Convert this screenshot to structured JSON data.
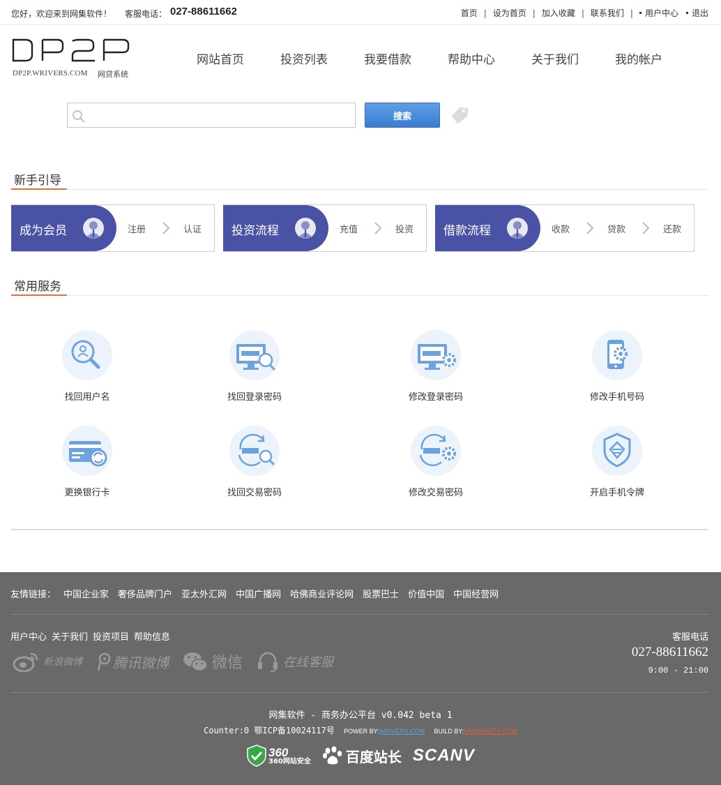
{
  "topbar": {
    "welcome": "您好，欢迎来到网集软件！",
    "service_label": "客服电话：",
    "service_phone": "027-88611662",
    "links": [
      "首页",
      "设为首页",
      "加入收藏",
      "联系我们",
      "用户中心",
      "退出"
    ]
  },
  "logo": {
    "text": "DP2P",
    "domain": "DP2P.WRIVERS.COM",
    "subtitle": "网贷系统"
  },
  "nav": [
    "网站首页",
    "投资列表",
    "我要借款",
    "帮助中心",
    "关于我们",
    "我的帐户"
  ],
  "search": {
    "placeholder": "",
    "button": "搜索"
  },
  "guide": {
    "title": "新手引导",
    "cards": [
      {
        "title": "成为会员",
        "steps": [
          "注册",
          "认证"
        ]
      },
      {
        "title": "投资流程",
        "steps": [
          "充值",
          "投资"
        ]
      },
      {
        "title": "借款流程",
        "steps": [
          "收款",
          "贷款",
          "还款"
        ]
      }
    ]
  },
  "services": {
    "title": "常用服务",
    "items": [
      {
        "label": "找回用户名",
        "icon": "user-search-icon"
      },
      {
        "label": "找回登录密码",
        "icon": "monitor-search-icon"
      },
      {
        "label": "修改登录密码",
        "icon": "monitor-gear-icon"
      },
      {
        "label": "修改手机号码",
        "icon": "phone-gear-icon"
      },
      {
        "label": "更换银行卡",
        "icon": "bank-card-icon"
      },
      {
        "label": "找回交易密码",
        "icon": "refresh-search-icon"
      },
      {
        "label": "修改交易密码",
        "icon": "refresh-gear-icon"
      },
      {
        "label": "开启手机令牌",
        "icon": "shield-token-icon"
      }
    ]
  },
  "footer": {
    "friend_label": "友情链接：",
    "friend_links": [
      "中国企业家",
      "奢侈品牌门户",
      "亚太外汇网",
      "中国广播网",
      "哈佛商业评论网",
      "股票巴士",
      "价值中国",
      "中国经营网"
    ],
    "nav": [
      "用户中心",
      "关于我们",
      "投资项目",
      "帮助信息"
    ],
    "social": [
      "新浪微博",
      "腾讯微博",
      "微信",
      "在线客服"
    ],
    "service_label": "客服电话",
    "service_phone": "027-88611662",
    "service_hours": "9:00 - 21:00",
    "copyright": "网集软件 - 商务办公平台 v0.042 beta 1",
    "counter": "Counter:0 鄂ICP备10024117号",
    "power_by_label": "POWER BY:",
    "power_by": "WRIVERS.COM",
    "build_by_label": "BUILD BY:",
    "build_by": "UNIONNETS.COM",
    "badges": [
      "360网站安全",
      "百度站长",
      "SCANV"
    ]
  },
  "colors": {
    "accent": "#4a52a6",
    "search_button": "#3b7dd0",
    "section_underline": "#d9743a",
    "footer_bg": "#696969",
    "icon_blue": "#6aa3e0"
  }
}
